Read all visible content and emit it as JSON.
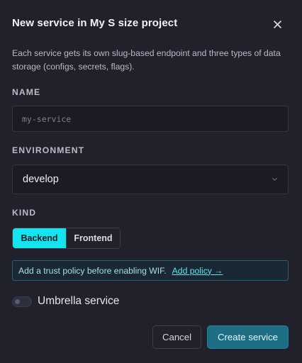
{
  "dialog": {
    "title": "New service in My S size project",
    "description": "Each service gets its own slug-based endpoint and three types of data storage (configs, secrets, flags)."
  },
  "name_field": {
    "label": "NAME",
    "placeholder": "my-service",
    "value": ""
  },
  "environment_field": {
    "label": "ENVIRONMENT",
    "selected": "develop"
  },
  "kind_field": {
    "label": "KIND",
    "options": [
      "Backend",
      "Frontend"
    ],
    "selected": "Backend"
  },
  "notice": {
    "text": "Add a trust policy before enabling WIF.",
    "link_label": "Add policy →"
  },
  "umbrella": {
    "label": "Umbrella service",
    "enabled": false
  },
  "actions": {
    "cancel_label": "Cancel",
    "create_label": "Create service"
  },
  "colors": {
    "background": "#20212b",
    "accent": "#13e4f0",
    "primary_button": "#1d6e85"
  },
  "icons": {
    "close": "close-icon",
    "chevron": "chevron-down-icon"
  }
}
